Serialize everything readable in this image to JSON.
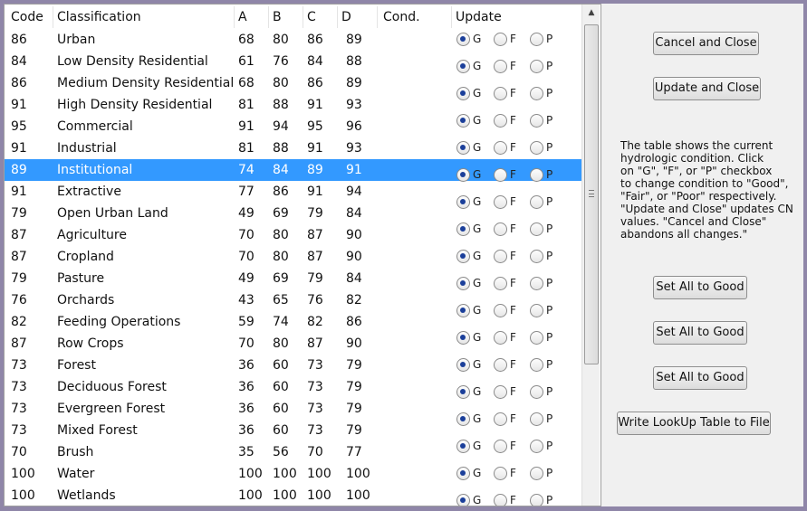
{
  "table": {
    "headers": {
      "code": "Code",
      "classification": "Classification",
      "a": "A",
      "b": "B",
      "c": "C",
      "d": "D",
      "cond": "Cond.",
      "update": "Update"
    },
    "rows": [
      {
        "code": "86",
        "classification": "Urban",
        "a": "68",
        "b": "80",
        "c": "86",
        "d": "89"
      },
      {
        "code": "84",
        "classification": "Low Density Residential",
        "a": "61",
        "b": "76",
        "c": "84",
        "d": "88"
      },
      {
        "code": "86",
        "classification": "Medium Density Residential",
        "a": "68",
        "b": "80",
        "c": "86",
        "d": "89"
      },
      {
        "code": "91",
        "classification": "High Density Residential",
        "a": "81",
        "b": "88",
        "c": "91",
        "d": "93"
      },
      {
        "code": "95",
        "classification": "Commercial",
        "a": "91",
        "b": "94",
        "c": "95",
        "d": "96"
      },
      {
        "code": "91",
        "classification": "Industrial",
        "a": "81",
        "b": "88",
        "c": "91",
        "d": "93"
      },
      {
        "code": "89",
        "classification": "Institutional",
        "a": "74",
        "b": "84",
        "c": "89",
        "d": "91"
      },
      {
        "code": "91",
        "classification": "Extractive",
        "a": "77",
        "b": "86",
        "c": "91",
        "d": "94"
      },
      {
        "code": "79",
        "classification": "Open Urban Land",
        "a": "49",
        "b": "69",
        "c": "79",
        "d": "84"
      },
      {
        "code": "87",
        "classification": "Agriculture",
        "a": "70",
        "b": "80",
        "c": "87",
        "d": "90"
      },
      {
        "code": "87",
        "classification": "Cropland",
        "a": "70",
        "b": "80",
        "c": "87",
        "d": "90"
      },
      {
        "code": "79",
        "classification": "Pasture",
        "a": "49",
        "b": "69",
        "c": "79",
        "d": "84"
      },
      {
        "code": "76",
        "classification": "Orchards",
        "a": "43",
        "b": "65",
        "c": "76",
        "d": "82"
      },
      {
        "code": "82",
        "classification": "Feeding Operations",
        "a": "59",
        "b": "74",
        "c": "82",
        "d": "86"
      },
      {
        "code": "87",
        "classification": "Row Crops",
        "a": "70",
        "b": "80",
        "c": "87",
        "d": "90"
      },
      {
        "code": "73",
        "classification": "Forest",
        "a": "36",
        "b": "60",
        "c": "73",
        "d": "79"
      },
      {
        "code": "73",
        "classification": "Deciduous Forest",
        "a": "36",
        "b": "60",
        "c": "73",
        "d": "79"
      },
      {
        "code": "73",
        "classification": "Evergreen Forest",
        "a": "36",
        "b": "60",
        "c": "73",
        "d": "79"
      },
      {
        "code": "73",
        "classification": "Mixed Forest",
        "a": "36",
        "b": "60",
        "c": "73",
        "d": "79"
      },
      {
        "code": "70",
        "classification": "Brush",
        "a": "35",
        "b": "56",
        "c": "70",
        "d": "77"
      },
      {
        "code": "100",
        "classification": "Water",
        "a": "100",
        "b": "100",
        "c": "100",
        "d": "100"
      },
      {
        "code": "100",
        "classification": "Wetlands",
        "a": "100",
        "b": "100",
        "c": "100",
        "d": "100"
      }
    ],
    "selected_row_index": 6,
    "radio_labels": {
      "good": "G",
      "fair": "F",
      "poor": "P"
    },
    "radio_rows": [
      {
        "selected": "G"
      },
      {
        "selected": "G"
      },
      {
        "selected": "G"
      },
      {
        "selected": "G"
      },
      {
        "selected": "G"
      },
      {
        "selected": "G"
      },
      {
        "selected": "G"
      },
      {
        "selected": "G"
      },
      {
        "selected": "G"
      },
      {
        "selected": "G"
      },
      {
        "selected": "G"
      },
      {
        "selected": "G"
      },
      {
        "selected": "G"
      },
      {
        "selected": "G"
      },
      {
        "selected": "G"
      },
      {
        "selected": "G"
      },
      {
        "selected": "G"
      },
      {
        "selected": "G"
      }
    ],
    "selected_color": "#3399ff"
  },
  "buttons": {
    "cancel_close": "Cancel and Close",
    "update_close": "Update and Close",
    "set_all_1": "Set All to Good",
    "set_all_2": "Set All to Good",
    "set_all_3": "Set All to Good",
    "write_lookup": "Write LookUp Table to File"
  },
  "info_text": "The table shows the current\nhydrologic condition. Click\non \"G\", \"F\", or \"P\" checkbox\nto change condition to \"Good\",\n\"Fair\", or \"Poor\" respectively.\n\"Update and Close\" updates CN\nvalues. \"Cancel and Close\"\nabandons all changes.\"",
  "icons": {
    "scroll_up": "scroll-up-arrow-icon",
    "thumb_grip": "scroll-grip-icon"
  }
}
